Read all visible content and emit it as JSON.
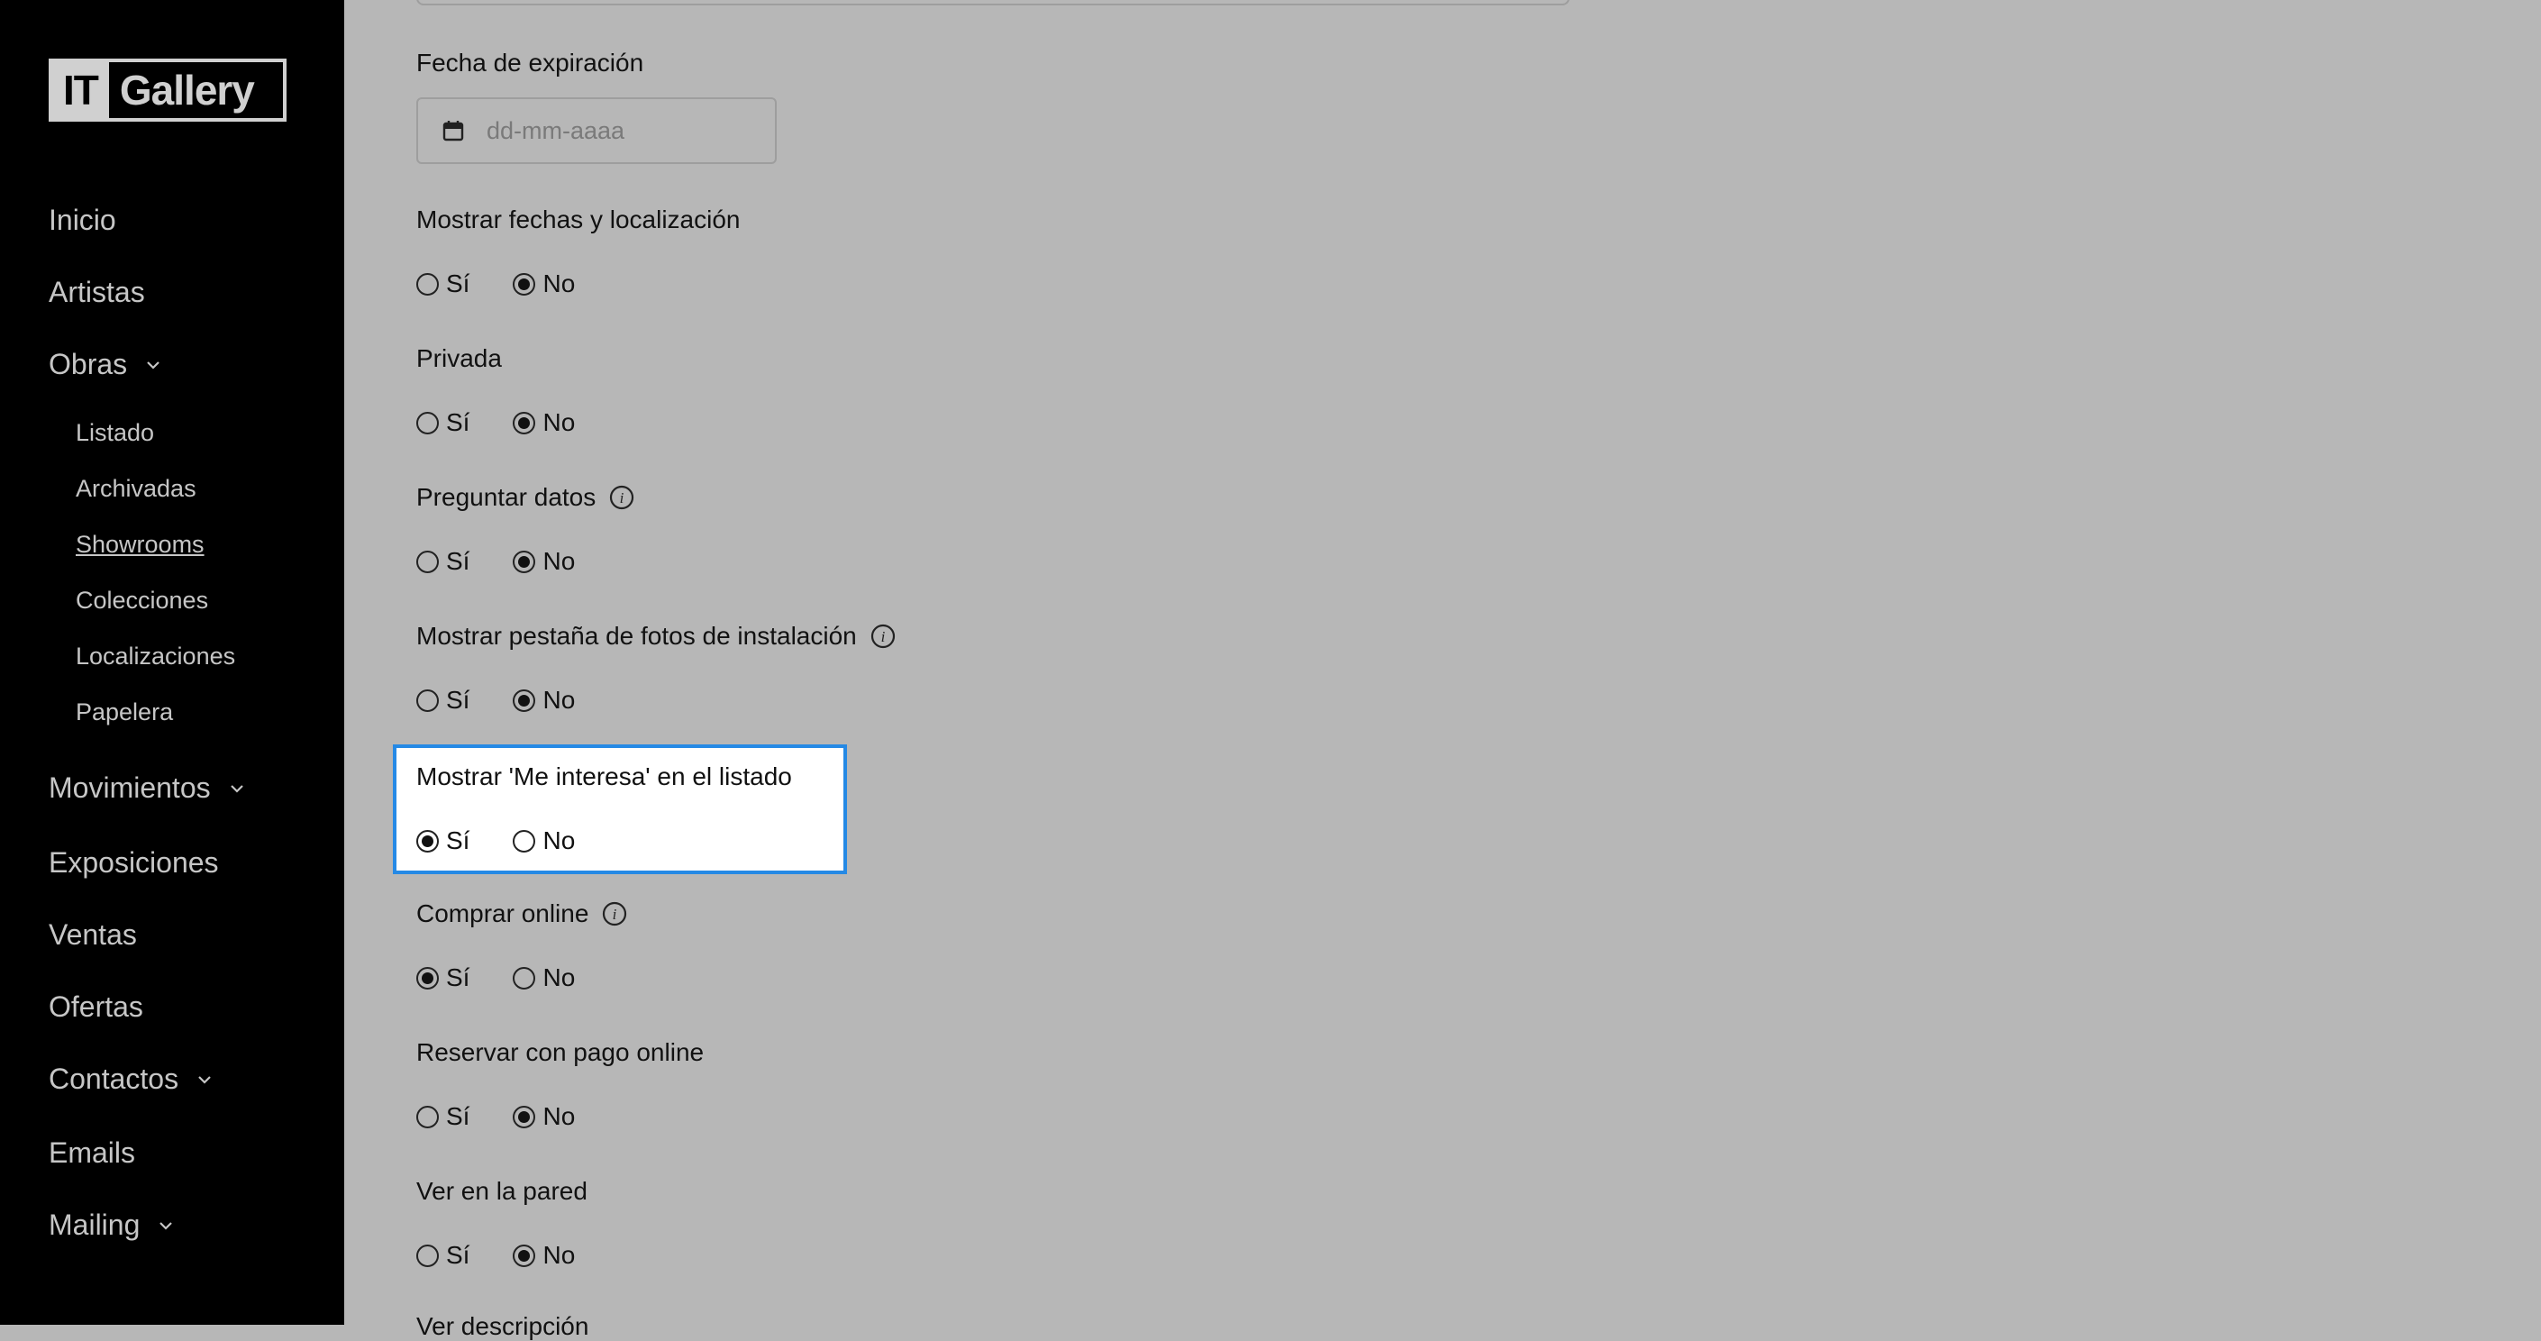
{
  "brand": {
    "it": "IT",
    "gallery": "Gallery"
  },
  "nav": {
    "inicio": "Inicio",
    "artistas": "Artistas",
    "obras": "Obras",
    "obras_sub": [
      "Listado",
      "Archivadas",
      "Showrooms",
      "Colecciones",
      "Localizaciones",
      "Papelera"
    ],
    "movimientos": "Movimientos",
    "exposiciones": "Exposiciones",
    "ventas": "Ventas",
    "ofertas": "Ofertas",
    "contactos": "Contactos",
    "emails": "Emails",
    "mailing": "Mailing"
  },
  "form": {
    "fecha_label": "Fecha de expiración",
    "fecha_placeholder": "dd-mm-aaaa",
    "yes": "Sí",
    "no": "No",
    "fields": [
      {
        "label": "Mostrar fechas y localización",
        "value": "No"
      },
      {
        "label": "Privada",
        "value": "No"
      },
      {
        "label": "Preguntar datos",
        "value": "No",
        "info": true
      },
      {
        "label": "Mostrar pestaña de fotos de instalación",
        "value": "No",
        "info": true
      },
      {
        "label": "Mostrar 'Me interesa' en el listado",
        "value": "Sí",
        "highlighted": true
      },
      {
        "label": "Comprar online",
        "value": "Sí",
        "info": true
      },
      {
        "label": "Reservar con pago online",
        "value": "No"
      },
      {
        "label": "Ver en la pared",
        "value": "No"
      }
    ],
    "partial_label": "Ver descripción"
  },
  "colors": {
    "highlight_border": "#2589e5",
    "sidebar_bg": "#000000",
    "overlay_bg": "#b7b7b7"
  }
}
